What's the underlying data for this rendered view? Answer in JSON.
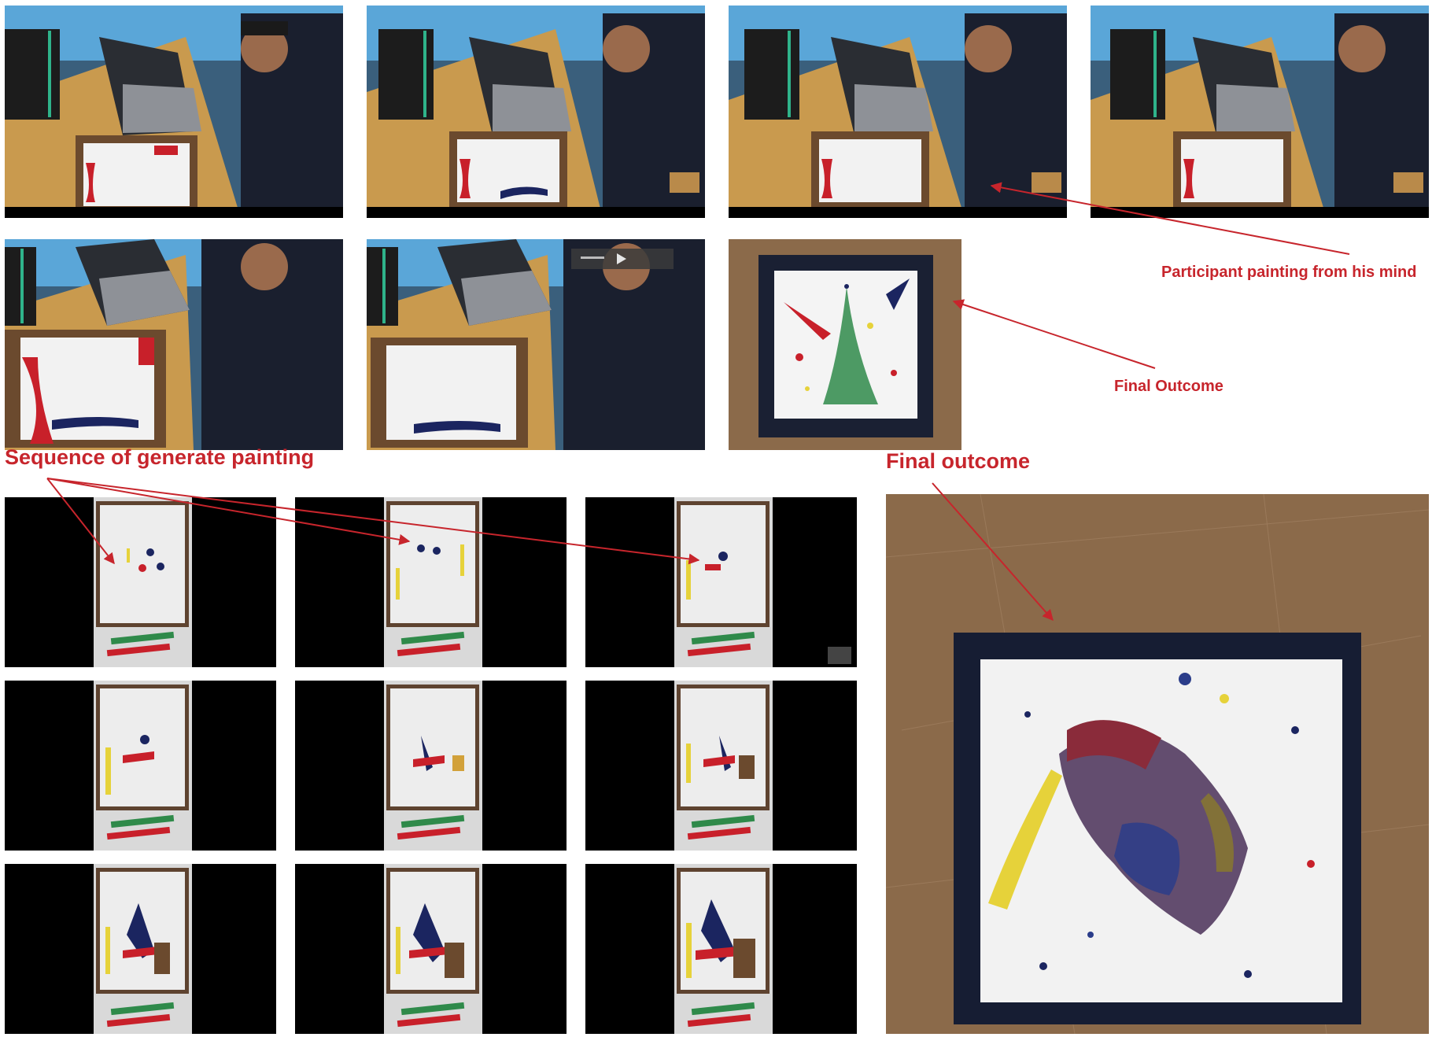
{
  "captions": {
    "participant": "Participant painting from his mind",
    "final_outcome_small": "Final Outcome",
    "sequence": "Sequence of generate painting",
    "final_outcome_large": "Final outcome"
  },
  "colors": {
    "annotation": "#c7252c",
    "desk": "#c99a4e",
    "paint_red": "#c8202a",
    "paint_navy": "#1b2560",
    "paint_yellow": "#e6d23a",
    "paint_green": "#2f8a4a",
    "board": "#8b6a4a"
  },
  "icons": {
    "frame_thumbnail": "video-thumbnail-icon",
    "player_controls": "video-player-controls-icon"
  }
}
